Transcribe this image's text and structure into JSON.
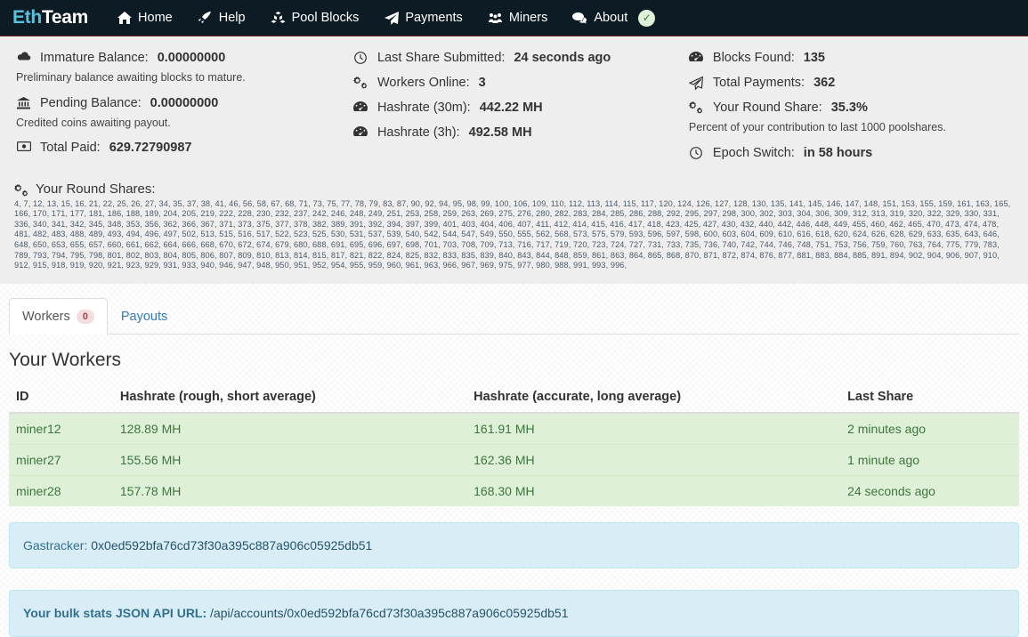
{
  "navbar": {
    "brand_primary": "Eth",
    "brand_secondary": "Team",
    "items": [
      {
        "label": "Home",
        "icon": "home-icon"
      },
      {
        "label": "Help",
        "icon": "rocket-icon"
      },
      {
        "label": "Pool Blocks",
        "icon": "cubes-icon"
      },
      {
        "label": "Payments",
        "icon": "paper-plane-icon"
      },
      {
        "label": "Miners",
        "icon": "users-icon"
      },
      {
        "label": "About",
        "icon": "comment-icon",
        "badge": "✓"
      }
    ]
  },
  "stats": {
    "col1": [
      {
        "icon": "cloud-icon",
        "label": "Immature Balance:",
        "value": "0.00000000",
        "help": "Preliminary balance awaiting blocks to mature."
      },
      {
        "icon": "bank-icon",
        "label": "Pending Balance:",
        "value": "0.00000000",
        "help": "Credited coins awaiting payout."
      },
      {
        "icon": "money-icon",
        "label": "Total Paid:",
        "value": "629.72790987",
        "help": ""
      }
    ],
    "col2": [
      {
        "icon": "clock-icon",
        "label": "Last Share Submitted:",
        "value": "24 seconds ago",
        "help": ""
      },
      {
        "icon": "cogs-icon",
        "label": "Workers Online:",
        "value": "3",
        "help": ""
      },
      {
        "icon": "dashboard-icon",
        "label": "Hashrate (30m):",
        "value": "442.22 MH",
        "help": ""
      },
      {
        "icon": "dashboard-icon",
        "label": "Hashrate (3h):",
        "value": "492.58 MH",
        "help": ""
      }
    ],
    "col3": [
      {
        "icon": "dashboard-icon",
        "label": "Blocks Found:",
        "value": "135",
        "help": ""
      },
      {
        "icon": "paper-plane-icon",
        "label": "Total Payments:",
        "value": "362",
        "help": ""
      },
      {
        "icon": "cogs-icon",
        "label": "Your Round Share:",
        "value": "35.3%",
        "help": "Percent of your contribution to last 1000 poolshares."
      },
      {
        "icon": "clock-icon",
        "label": "Epoch Switch:",
        "value": "in 58 hours",
        "help": ""
      }
    ]
  },
  "round_shares": {
    "icon": "cogs-icon",
    "title": "Your Round Shares:",
    "values": "4, 7, 12, 13, 15, 16, 21, 22, 25, 26, 27, 34, 35, 37, 38, 41, 46, 56, 58, 67, 68, 71, 73, 75, 77, 78, 79, 83, 87, 90, 92, 94, 95, 98, 99, 100, 106, 109, 110, 112, 113, 114, 115, 117, 120, 124, 126, 127, 128, 130, 135, 141, 145, 146, 147, 148, 151, 153, 155, 159, 161, 163, 165, 166, 170, 171, 177, 181, 186, 188, 189, 204, 205, 219, 222, 228, 230, 232, 237, 242, 246, 248, 249, 251, 253, 258, 259, 263, 269, 275, 276, 280, 282, 283, 284, 285, 286, 288, 292, 295, 297, 298, 300, 302, 303, 304, 306, 309, 312, 313, 319, 320, 322, 329, 330, 331, 336, 340, 341, 342, 345, 348, 353, 356, 362, 366, 367, 371, 373, 375, 377, 378, 382, 389, 391, 392, 394, 397, 399, 401, 403, 404, 406, 407, 411, 412, 414, 415, 416, 417, 418, 423, 425, 427, 430, 432, 440, 442, 446, 448, 449, 455, 460, 462, 465, 470, 473, 474, 478, 481, 482, 483, 488, 489, 493, 494, 496, 497, 502, 513, 515, 516, 517, 522, 523, 525, 530, 531, 537, 539, 540, 542, 544, 547, 549, 550, 555, 562, 568, 573, 575, 579, 593, 596, 597, 598, 600, 603, 604, 609, 610, 616, 618, 620, 624, 626, 628, 629, 633, 635, 643, 646, 648, 650, 653, 655, 657, 660, 661, 662, 664, 666, 668, 670, 672, 674, 679, 680, 688, 691, 695, 696, 697, 698, 701, 703, 708, 709, 713, 716, 717, 719, 720, 723, 724, 727, 731, 733, 735, 736, 740, 742, 744, 746, 748, 751, 753, 756, 759, 760, 763, 764, 775, 779, 783, 789, 793, 794, 795, 798, 801, 802, 803, 804, 805, 806, 807, 809, 810, 813, 814, 815, 817, 821, 822, 824, 825, 832, 833, 835, 839, 840, 843, 844, 848, 859, 861, 863, 864, 865, 868, 870, 871, 872, 874, 876, 877, 881, 883, 884, 885, 891, 894, 902, 904, 906, 907, 910, 912, 915, 918, 919, 920, 921, 923, 929, 931, 933, 940, 946, 947, 948, 950, 951, 952, 954, 955, 959, 960, 961, 963, 966, 967, 969, 975, 977, 980, 988, 991, 993, 996,"
  },
  "tabs": [
    {
      "label": "Workers",
      "badge": "0",
      "active": true
    },
    {
      "label": "Payouts",
      "badge": "",
      "active": false
    }
  ],
  "workers_panel": {
    "title": "Your Workers",
    "columns": [
      "ID",
      "Hashrate (rough, short average)",
      "Hashrate (accurate, long average)",
      "Last Share"
    ],
    "rows": [
      {
        "id": "miner12",
        "hashrate_short": "128.89 MH",
        "hashrate_long": "161.91 MH",
        "last_share": "2 minutes ago"
      },
      {
        "id": "miner27",
        "hashrate_short": "155.56 MH",
        "hashrate_long": "162.36 MH",
        "last_share": "1 minute ago"
      },
      {
        "id": "miner28",
        "hashrate_short": "157.78 MH",
        "hashrate_long": "168.30 MH",
        "last_share": "24 seconds ago"
      }
    ]
  },
  "alerts": {
    "gastracker_label": "Gastracker:",
    "gastracker_address": "0x0ed592bfa76cd73f30a395c887a906c05925db51",
    "api_label": "Your bulk stats JSON API URL:",
    "api_url": "/api/accounts/0x0ed592bfa76cd73f30a395c887a906c05925db51"
  },
  "colors": {
    "navbar_bg": "#0d1b24",
    "brand_accent": "#5bc0de",
    "jumbo_bg": "#eeeeee",
    "success_row_bg": "#dff0d8",
    "info_alert_bg": "#d9edf7",
    "link": "#337ab7"
  }
}
